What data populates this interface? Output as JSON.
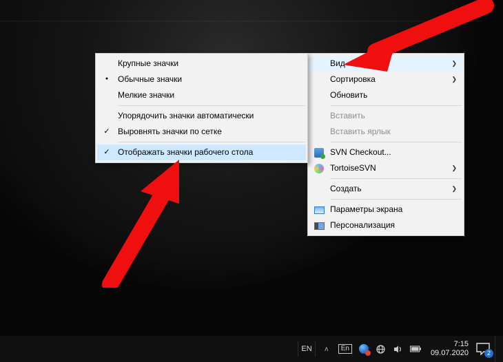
{
  "desktop_wallpaper": "death-star-dark",
  "menu_main": {
    "items": [
      {
        "label": "Вид",
        "submenu": true,
        "highlighted": true
      },
      {
        "label": "Сортировка",
        "submenu": true
      },
      {
        "label": "Обновить"
      },
      "---",
      {
        "label": "Вставить",
        "disabled": true
      },
      {
        "label": "Вставить ярлык",
        "disabled": true
      },
      "---",
      {
        "label": "SVN Checkout...",
        "icon": "svn-checkout"
      },
      {
        "label": "TortoiseSVN",
        "icon": "tortoisesvn",
        "submenu": true
      },
      "---",
      {
        "label": "Создать",
        "submenu": true
      },
      "---",
      {
        "label": "Параметры экрана",
        "icon": "display-settings"
      },
      {
        "label": "Персонализация",
        "icon": "personalization"
      }
    ]
  },
  "menu_view": {
    "items": [
      {
        "label": "Крупные значки"
      },
      {
        "label": "Обычные значки",
        "bullet": true
      },
      {
        "label": "Мелкие значки"
      },
      "---",
      {
        "label": "Упорядочить значки автоматически"
      },
      {
        "label": "Выровнять значки по сетке",
        "check": true
      },
      "---",
      {
        "label": "Отображать значки рабочего стола",
        "check": true,
        "highlighted": true
      }
    ]
  },
  "taskbar": {
    "lang_code": "EN",
    "lang_badge": "En",
    "time": "7:15",
    "date": "09.07.2020",
    "notif_count": "2"
  },
  "colors": {
    "menu_bg": "#f2f2f2",
    "menu_hover": "#e5f3ff",
    "taskbar_bg": "#101010",
    "arrow_red": "#ef0f0f"
  }
}
